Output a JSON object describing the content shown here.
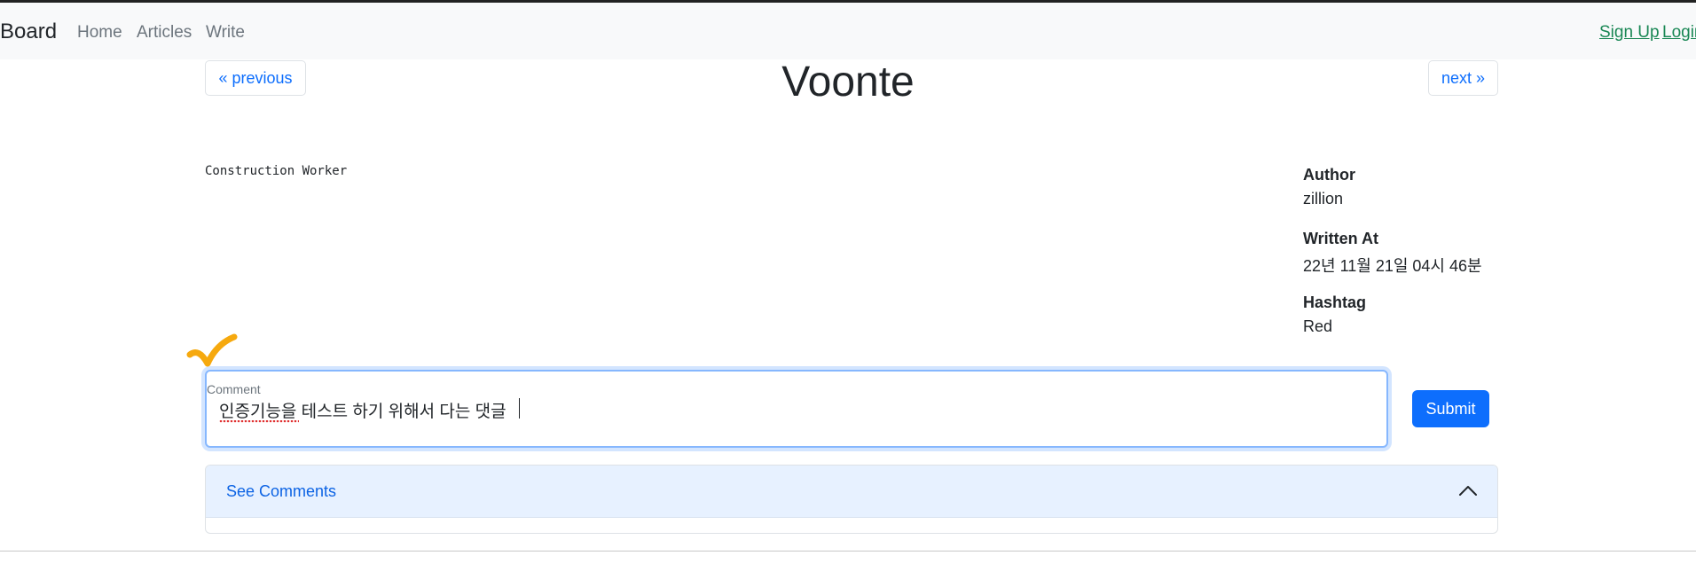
{
  "nav": {
    "brand": "Board",
    "links": [
      "Home",
      "Articles",
      "Write"
    ],
    "signup": "Sign Up",
    "login": "Login"
  },
  "pager": {
    "previous": "« previous",
    "next": "next »"
  },
  "article": {
    "title": "Voonte",
    "content": "Construction Worker",
    "meta": [
      {
        "label": "Author",
        "value": "zillion"
      },
      {
        "label": "Written At",
        "value": "22년 11월 21일 04시 46분"
      },
      {
        "label": "Hashtag",
        "value": "Red"
      }
    ]
  },
  "comment": {
    "label": "Comment",
    "value": "인증기능을 테스트 하기 위해서 다는 댓글",
    "submit": "Submit"
  },
  "accordion": {
    "title": "See Comments"
  },
  "colors": {
    "primary": "#0d6efd",
    "success": "#198754",
    "annotation": "#f6a90e"
  }
}
